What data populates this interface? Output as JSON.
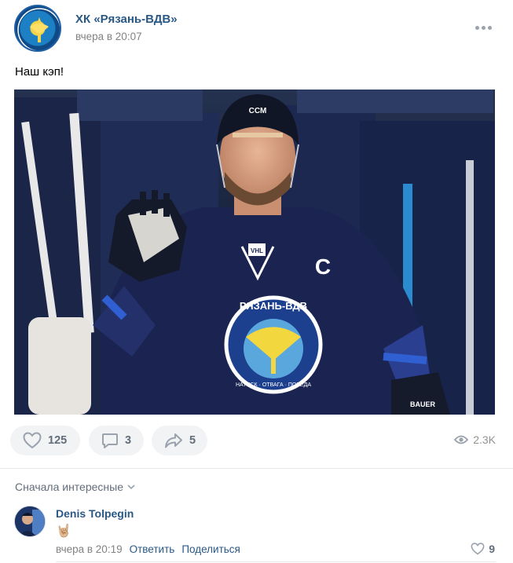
{
  "post": {
    "group_name": "ХК «Рязань-ВДВ»",
    "time": "вчера в 20:07",
    "text": "Наш кэп!",
    "photo": {
      "jersey_text": "РЯЗАНЬ-ВДВ",
      "jersey_motto": "НАТИСК · ОТВАГА · ПОБЕДА",
      "captain_letter": "C",
      "league_badge": "VHL",
      "helmet_brand": "CCM",
      "glove_brand": "BAUER"
    },
    "likes": "125",
    "comments": "3",
    "shares": "5",
    "views": "2.3K"
  },
  "comments_section": {
    "sort_label": "Сначала интересные",
    "items": [
      {
        "author": "Denis Tolpegin",
        "text": "🤘🏼",
        "time": "вчера в 20:19",
        "reply_label": "Ответить",
        "share_label": "Поделиться",
        "likes": "9"
      }
    ]
  },
  "icons": {
    "more": "more-horizontal-icon",
    "like": "heart-icon",
    "comment": "comment-icon",
    "share": "share-arrow-icon",
    "views": "eye-icon",
    "sort": "chevron-down-icon"
  },
  "colors": {
    "link": "#2a5885",
    "muted": "#828282",
    "button_bg": "#f2f3f5",
    "icon": "#99a2ad"
  }
}
